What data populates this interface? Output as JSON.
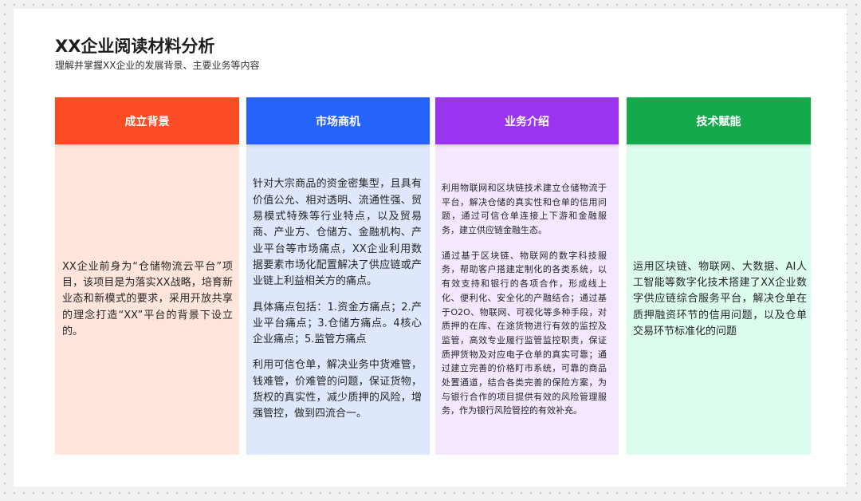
{
  "header": {
    "title": "XX企业阅读材料分析",
    "subtitle": "理解并掌握XX企业的发展背景、主要业务等内容"
  },
  "columns": [
    {
      "heading": "成立背景",
      "accent": "#fc4c23",
      "tint": "#ffe5db",
      "paragraphs": [
        "XX企业前身为“仓储物流云平台”项目，该项目是为落实XX战略，培育新业态和新模式的要求，采用开放共享的理念打造“XX”平台的背景下设立的。"
      ]
    },
    {
      "heading": "市场商机",
      "accent": "#2563fa",
      "tint": "#dee7fb",
      "paragraphs": [
        "针对大宗商品的资金密集型，且具有价值公允、相对透明、流通性强、贸易模式特殊等行业特点，以及贸易商、产业方、仓储方、金融机构、产业平台等市场痛点，XX企业利用数据要素市场化配置解决了供应链或产业链上利益相关方的痛点。",
        "具体痛点包括：1.资金方痛点；2.产业平台痛点；3.仓储方痛点。4核心企业痛点；5.监管方痛点",
        "利用可信仓单，解决业务中货难管，钱难管，价难管的问题，保证货物，货权的真实性，减少质押的风险，增强管控，做到四流合一。"
      ]
    },
    {
      "heading": "业务介绍",
      "accent": "#9a34ee",
      "tint": "#f3e8ff",
      "paragraphs": [
        "利用物联网和区块链技术建立仓储物流于平台，解决仓储的真实性和仓单的信用问题，通过可信仓单连接上下游和金融服务，建立供应链金融生态。",
        "通过基于区块链、物联网的数字科技服务，帮助客户搭建定制化的各类系统，以有效支持和银行的各项合作，形成线上化、便利化、安全化的产融结合；通过基于O2O、物联网、可视化等多种手段，对质押的在库、在途货物进行有效的监控及监管，高效专业履行监管监控职责，保证质押货物及对应电子仓单的真实可靠；通过建立完善的价格盯市系统，可靠的商品处置通道，结合各类完善的保险方案，为与银行合作的项目提供有效的风险管理服务，作为银行风险管控的有效补充。"
      ]
    },
    {
      "heading": "技术赋能",
      "accent": "#14a94a",
      "tint": "#dcfdee",
      "paragraphs": [
        "运用区块链、物联网、大数据、AI人工智能等数字化技术搭建了XX企业数字供应链综合服务平台，解决仓单在质押融资环节的信用问题，以及仓单交易环节标准化的问题"
      ]
    }
  ]
}
